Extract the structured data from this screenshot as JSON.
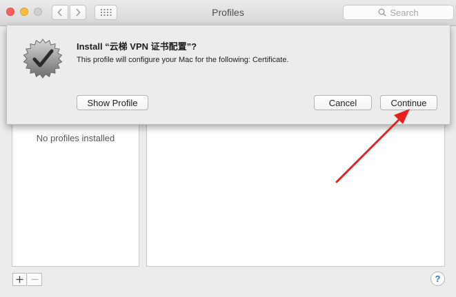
{
  "window": {
    "title": "Profiles",
    "search_placeholder": "Search"
  },
  "icons": {
    "back": "chevron-left-icon",
    "forward": "chevron-right-icon",
    "show_all": "grid-icon",
    "search": "search-icon",
    "badge": "checkmark-badge-icon",
    "arrow": "red-arrow-annotation"
  },
  "profiles": {
    "empty_message": "No profiles installed",
    "add_label": "+",
    "remove_label": "—",
    "help_label": "?"
  },
  "dialog": {
    "title": "Install “云梯 VPN 证书配置”?",
    "description": "This profile will configure your Mac for the following: Certificate.",
    "show_profile_label": "Show Profile",
    "cancel_label": "Cancel",
    "continue_label": "Continue"
  },
  "colors": {
    "close": "#fc605c",
    "minimize": "#fdbc40",
    "annotation_arrow": "#e82020",
    "help_accent": "#2e72d8"
  }
}
